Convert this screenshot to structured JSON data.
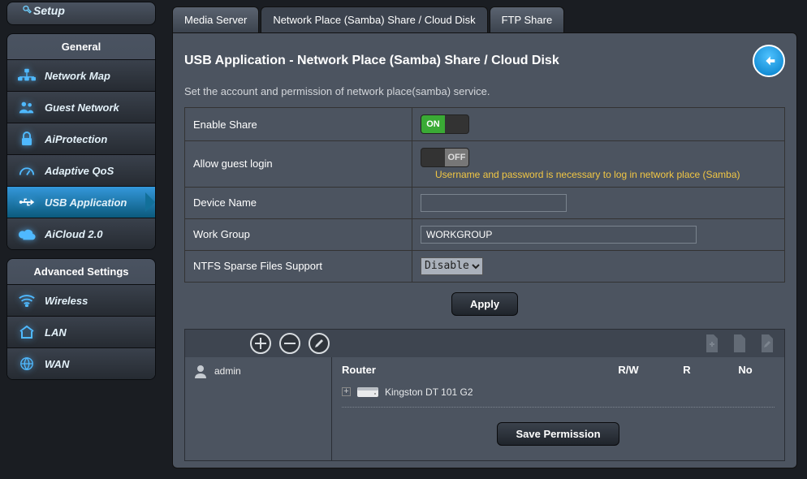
{
  "sidebar": {
    "setup_label": "Setup",
    "general_header": "General",
    "advanced_header": "Advanced Settings",
    "items": [
      {
        "id": "network-map",
        "label": "Network Map"
      },
      {
        "id": "guest-network",
        "label": "Guest Network"
      },
      {
        "id": "aiprotection",
        "label": "AiProtection"
      },
      {
        "id": "adaptive-qos",
        "label": "Adaptive QoS"
      },
      {
        "id": "usb-application",
        "label": "USB Application"
      },
      {
        "id": "aicloud",
        "label": "AiCloud 2.0"
      }
    ],
    "adv_items": [
      {
        "id": "wireless",
        "label": "Wireless"
      },
      {
        "id": "lan",
        "label": "LAN"
      },
      {
        "id": "wan",
        "label": "WAN"
      }
    ]
  },
  "tabs": {
    "media_server": "Media Server",
    "samba": "Network Place (Samba) Share / Cloud Disk",
    "ftp": "FTP Share"
  },
  "panel": {
    "title": "USB Application - Network Place (Samba) Share / Cloud Disk",
    "subtitle": "Set the account and permission of network place(samba) service."
  },
  "form": {
    "enable_share_label": "Enable Share",
    "enable_share_value": "ON",
    "allow_guest_label": "Allow guest login",
    "allow_guest_value": "OFF",
    "allow_guest_hint": "Username and password is necessary to log in network place (Samba)",
    "device_name_label": "Device Name",
    "device_name_value": "",
    "work_group_label": "Work Group",
    "work_group_value": "WORKGROUP",
    "ntfs_label": "NTFS Sparse Files Support",
    "ntfs_value": "Disable",
    "apply_label": "Apply",
    "toggle_on": "ON",
    "toggle_off": "OFF"
  },
  "perm": {
    "user": "admin",
    "col_router": "Router",
    "col_rw": "R/W",
    "col_r": "R",
    "col_no": "No",
    "device": "Kingston DT 101 G2",
    "save_label": "Save Permission"
  }
}
